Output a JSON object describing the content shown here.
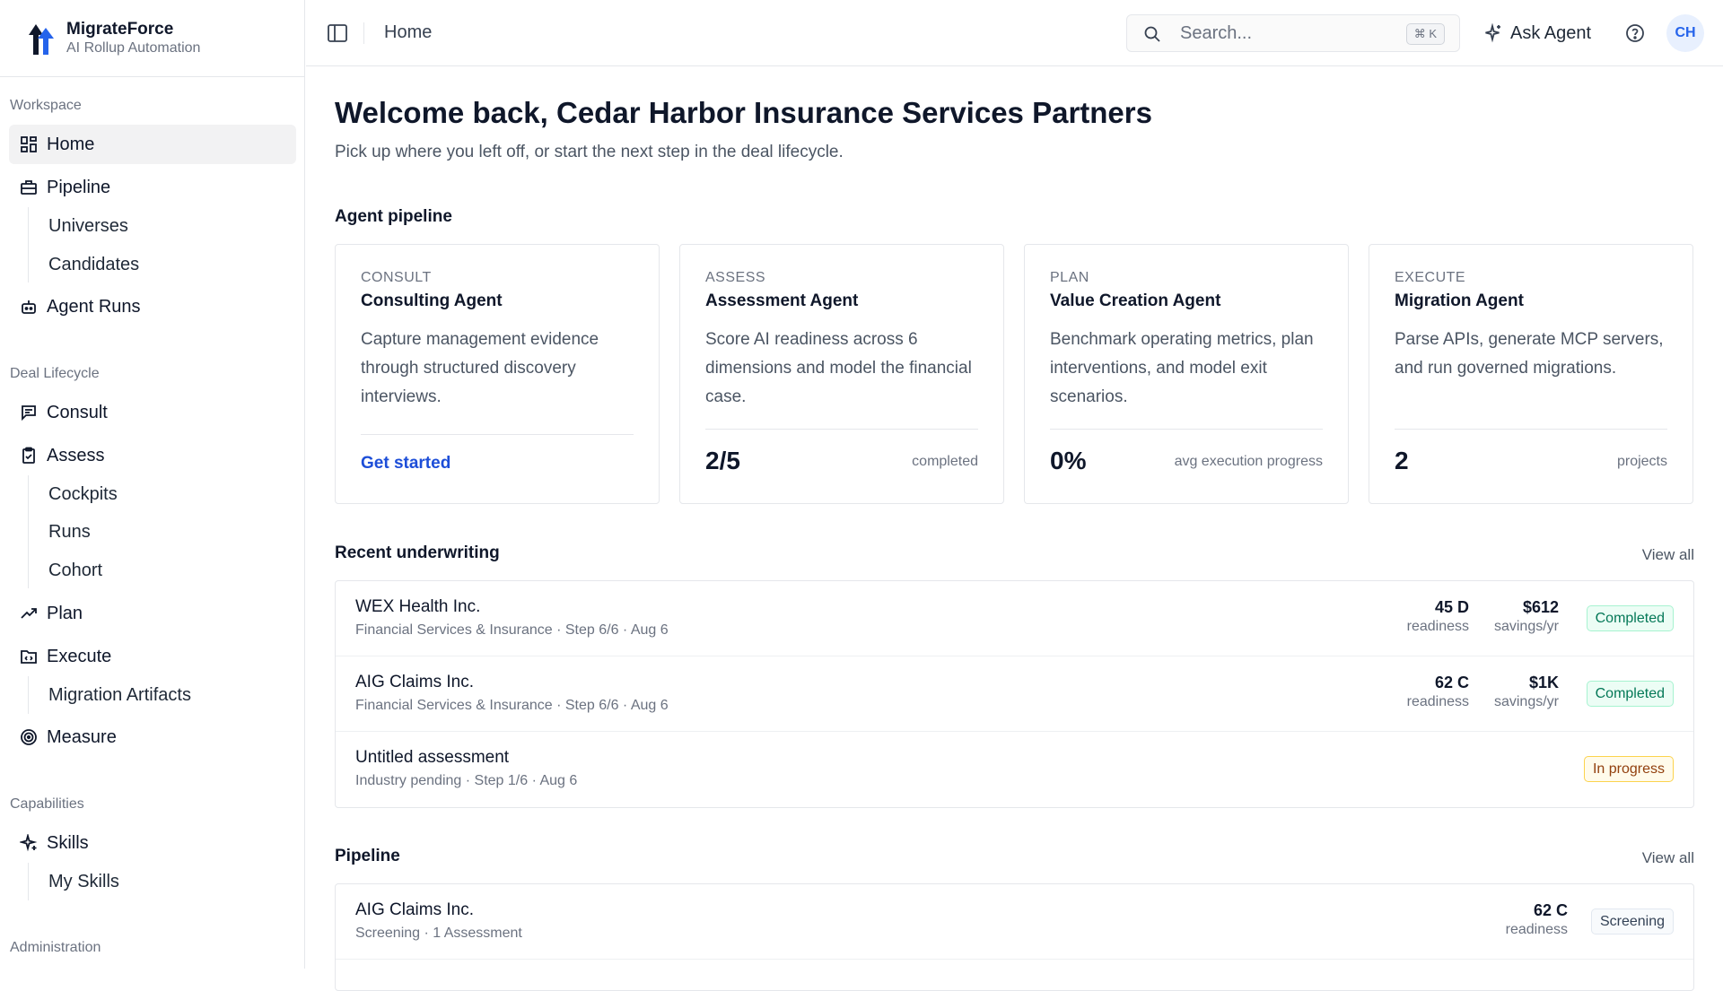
{
  "brand": {
    "name": "MigrateForce",
    "subtitle": "AI Rollup Automation"
  },
  "sidebar": {
    "sections": [
      {
        "label": "Workspace"
      },
      {
        "label": "Deal Lifecycle"
      },
      {
        "label": "Capabilities"
      },
      {
        "label": "Administration"
      }
    ],
    "items": {
      "home": "Home",
      "pipeline": "Pipeline",
      "universes": "Universes",
      "candidates": "Candidates",
      "agent_runs": "Agent Runs",
      "consult": "Consult",
      "assess": "Assess",
      "cockpits": "Cockpits",
      "runs": "Runs",
      "cohort": "Cohort",
      "plan": "Plan",
      "execute": "Execute",
      "migration_artifacts": "Migration Artifacts",
      "measure": "Measure",
      "skills": "Skills",
      "my_skills": "My Skills"
    },
    "active": "home"
  },
  "header": {
    "breadcrumb": "Home",
    "search_placeholder": "Search...",
    "search_shortcut": "⌘ K",
    "ask_label": "Ask Agent",
    "avatar_initials": "CH"
  },
  "main": {
    "title": "Welcome back, Cedar Harbor Insurance Services Partners",
    "subtitle": "Pick up where you left off, or start the next step in the deal lifecycle.",
    "agent_pipeline": {
      "title": "Agent pipeline",
      "cards": [
        {
          "tag": "CONSULT",
          "title": "Consulting Agent",
          "desc": "Capture management evidence through structured discovery interviews.",
          "cta": "Get started"
        },
        {
          "tag": "ASSESS",
          "title": "Assessment Agent",
          "desc": "Score AI readiness across 6 dimensions and model the financial case.",
          "metric": "2/5",
          "metric_label": "completed"
        },
        {
          "tag": "PLAN",
          "title": "Value Creation Agent",
          "desc": "Benchmark operating metrics, plan interventions, and model exit scenarios.",
          "metric": "0%",
          "metric_label": "avg execution progress"
        },
        {
          "tag": "EXECUTE",
          "title": "Migration Agent",
          "desc": "Parse APIs, generate MCP servers, and run governed migrations.",
          "metric": "2",
          "metric_label": "projects"
        }
      ]
    },
    "recent_underwriting": {
      "title": "Recent underwriting",
      "view_all": "View all",
      "rows": [
        {
          "name": "WEX Health Inc.",
          "meta": "Financial Services & Insurance · Step 6/6 · Aug 6",
          "readiness": "45 D",
          "readiness_label": "readiness",
          "savings": "$612",
          "savings_label": "savings/yr",
          "status": "Completed"
        },
        {
          "name": "AIG Claims Inc.",
          "meta": "Financial Services & Insurance · Step 6/6 · Aug 6",
          "readiness": "62 C",
          "readiness_label": "readiness",
          "savings": "$1K",
          "savings_label": "savings/yr",
          "status": "Completed"
        },
        {
          "name": "Untitled assessment",
          "meta": "Industry pending · Step 1/6 · Aug 6",
          "status": "In progress"
        }
      ]
    },
    "pipeline": {
      "title": "Pipeline",
      "view_all": "View all",
      "rows": [
        {
          "name": "AIG Claims Inc.",
          "meta": "Screening · 1 Assessment",
          "readiness": "62 C",
          "readiness_label": "readiness",
          "status": "Screening"
        }
      ]
    }
  },
  "colors": {
    "accent": "#1d4ed8",
    "completed": "#047857",
    "in_progress": "#92400e"
  }
}
